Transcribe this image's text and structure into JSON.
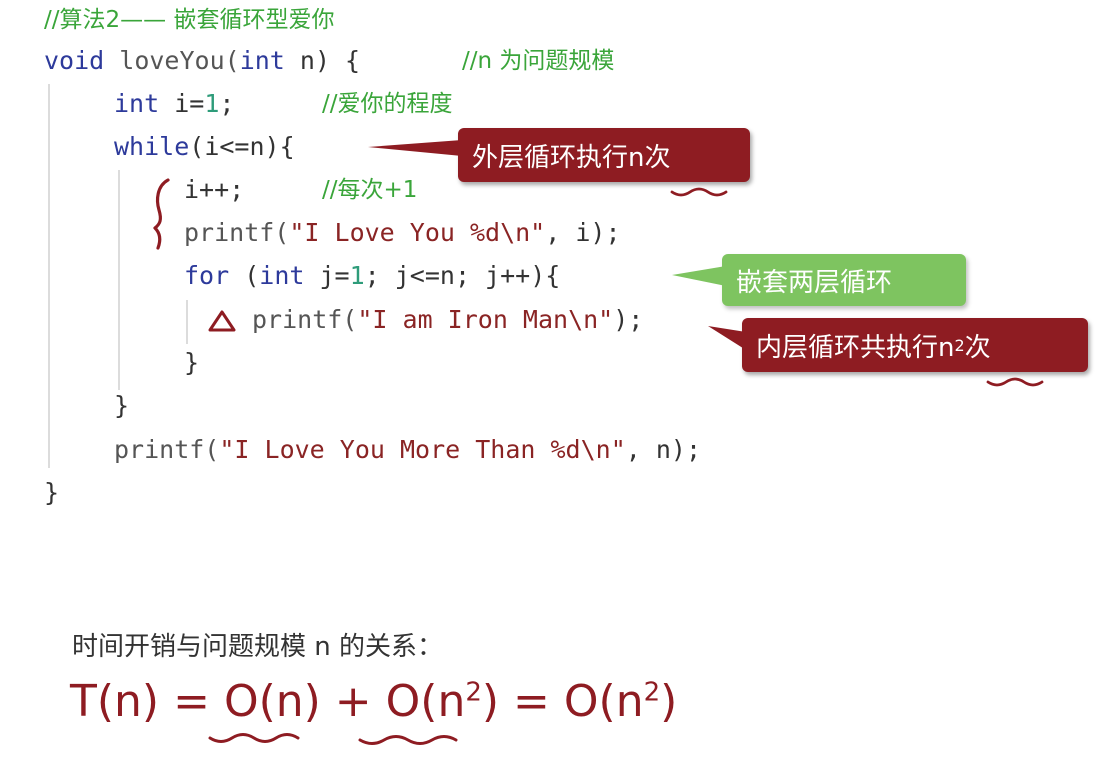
{
  "code": {
    "line1": {
      "comment": "//算法2—— 嵌套循环型爱你"
    },
    "line2": {
      "kw_void": "void",
      "fn_name": " loveYou(",
      "kw_int": "int",
      "rest": " n) {",
      "comment": "//n 为问题规模"
    },
    "line3": {
      "kw_int": "int",
      "before": " i=",
      "num": "1",
      "after": ";",
      "comment": "//爱你的程度"
    },
    "line4": {
      "kw_while": "while",
      "rest": "(i<=n){"
    },
    "line5": {
      "code": "i++;",
      "comment": "//每次+1"
    },
    "line6": {
      "fn": "printf(",
      "str": "\"I Love You %d\\n\"",
      "rest": ", i);"
    },
    "line7": {
      "kw_for": "for",
      "paren": " (",
      "kw_int": "int",
      "a": " j=",
      "num": "1",
      "rest": "; j<=n; j++){"
    },
    "line8": {
      "fn": "printf(",
      "str": "\"I am Iron Man\\n\"",
      "rest": ");"
    },
    "line9": {
      "text": "}"
    },
    "line10": {
      "text": "}"
    },
    "line11": {
      "fn": "printf(",
      "str": "\"I Love You More Than %d\\n\"",
      "rest": ", n);"
    },
    "line12": {
      "text": "}"
    }
  },
  "callouts": {
    "outer": "外层循环执行n次",
    "nested": "嵌套两层循环",
    "inner_prefix": "内层循环共执行n",
    "inner_sup": "2",
    "inner_suffix": "次"
  },
  "description": "时间开销与问题规模 n 的关系：",
  "formula": {
    "lhs": "T(n) = ",
    "term1": "O(n)",
    "plus": " + ",
    "term2_base": "O(n",
    "term2_sup": "2",
    "term2_close": ")",
    "eq": " = ",
    "term3_base": "O(n",
    "term3_sup": "2",
    "term3_close": ")"
  },
  "colors": {
    "callout_red": "#8e1c22",
    "callout_green": "#7ec460",
    "annotation": "#8e1c22",
    "comment": "#3aa53a",
    "keyword": "#2d3a9b"
  }
}
